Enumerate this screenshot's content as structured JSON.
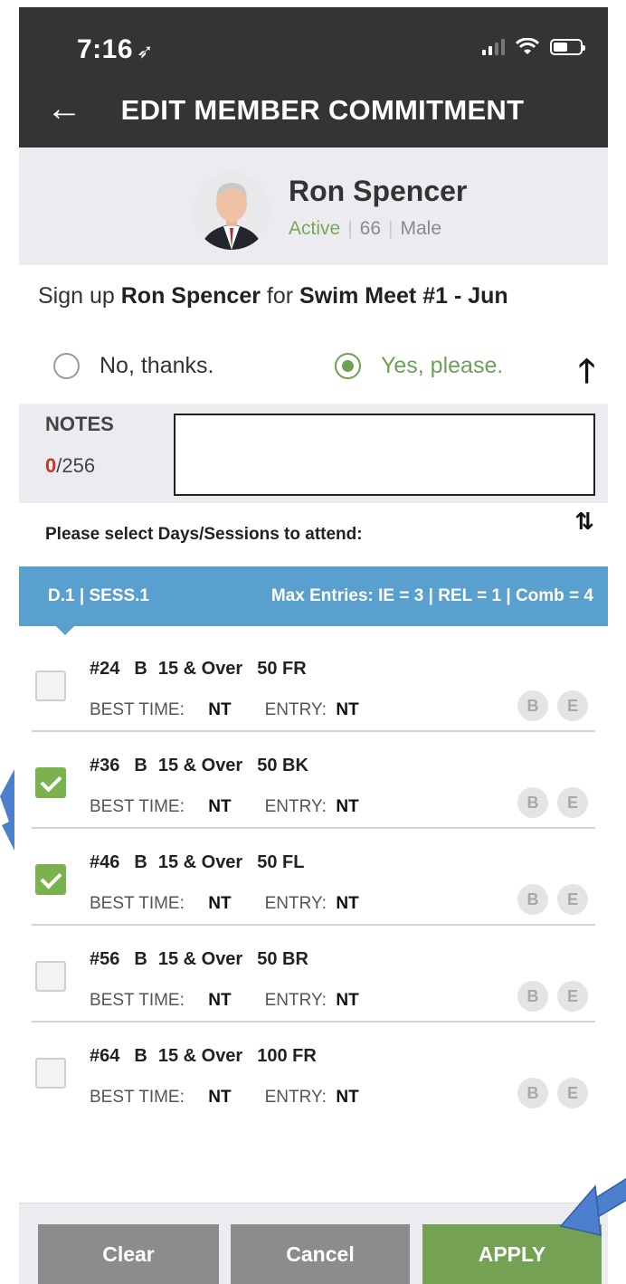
{
  "status_bar": {
    "time": "7:16",
    "location_glyph": "➶"
  },
  "header": {
    "back_glyph": "←",
    "title": "EDIT MEMBER COMMITMENT"
  },
  "member": {
    "name": "Ron Spencer",
    "status": "Active",
    "age": "66",
    "gender": "Male",
    "meta_separator": "|"
  },
  "signup": {
    "prefix": "Sign up",
    "member_name": "Ron Spencer",
    "middle": "for",
    "meet": "Swim Meet #1 - Jun"
  },
  "response": {
    "no_label": "No, thanks.",
    "yes_label": "Yes, please.",
    "selected": "yes",
    "collapse_glyph": "🡑"
  },
  "notes": {
    "label": "NOTES",
    "count": "0",
    "max": "/256",
    "value": ""
  },
  "sessions": {
    "prompt": "Please select Days/Sessions to attend:",
    "expand_glyph": "⇅"
  },
  "session_bar": {
    "left": "D.1 | SESS.1",
    "right": "Max Entries: IE = 3 | REL = 1 | Comb = 4"
  },
  "events": [
    {
      "number": "#24",
      "class": "B",
      "age_group": "15 & Over",
      "event": "50 FR",
      "checked": false,
      "best_time_label": "BEST TIME:",
      "best_time": "NT",
      "entry_label": "ENTRY:",
      "entry": "NT",
      "badge_b": "B",
      "badge_e": "E"
    },
    {
      "number": "#36",
      "class": "B",
      "age_group": "15 & Over",
      "event": "50 BK",
      "checked": true,
      "best_time_label": "BEST TIME:",
      "best_time": "NT",
      "entry_label": "ENTRY:",
      "entry": "NT",
      "badge_b": "B",
      "badge_e": "E"
    },
    {
      "number": "#46",
      "class": "B",
      "age_group": "15 & Over",
      "event": "50 FL",
      "checked": true,
      "best_time_label": "BEST TIME:",
      "best_time": "NT",
      "entry_label": "ENTRY:",
      "entry": "NT",
      "badge_b": "B",
      "badge_e": "E"
    },
    {
      "number": "#56",
      "class": "B",
      "age_group": "15 & Over",
      "event": "50 BR",
      "checked": false,
      "best_time_label": "BEST TIME:",
      "best_time": "NT",
      "entry_label": "ENTRY:",
      "entry": "NT",
      "badge_b": "B",
      "badge_e": "E"
    },
    {
      "number": "#64",
      "class": "B",
      "age_group": "15 & Over",
      "event": "100 FR",
      "checked": false,
      "best_time_label": "BEST TIME:",
      "best_time": "NT",
      "entry_label": "ENTRY:",
      "entry": "NT",
      "badge_b": "B",
      "badge_e": "E"
    }
  ],
  "footer": {
    "clear_label": "Clear",
    "cancel_label": "Cancel",
    "apply_label": "APPLY"
  },
  "colors": {
    "header": "#343434",
    "accent_green": "#74a252",
    "session_blue": "#5aa0cf",
    "panel_gray": "#ececf0",
    "pointer_blue": "#4d7fcf"
  }
}
